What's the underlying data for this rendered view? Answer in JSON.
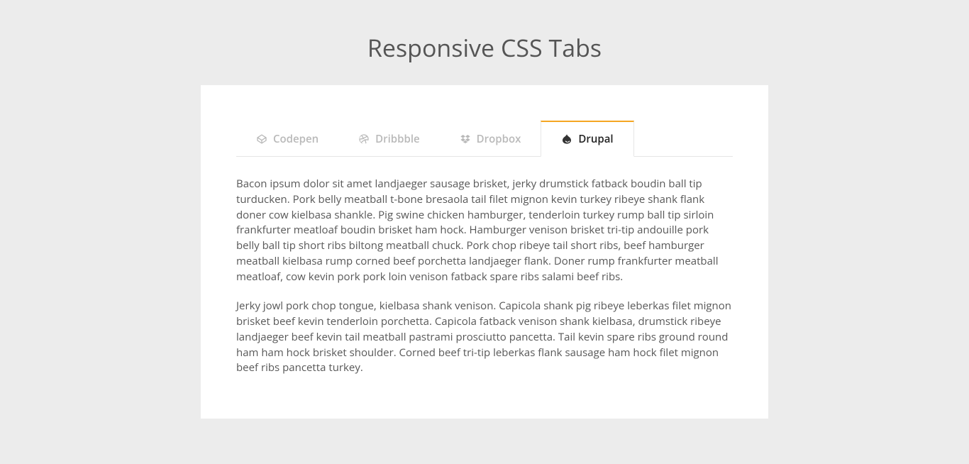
{
  "page": {
    "title": "Responsive CSS Tabs"
  },
  "tabs": {
    "items": [
      {
        "label": "Codepen"
      },
      {
        "label": "Dribbble"
      },
      {
        "label": "Dropbox"
      },
      {
        "label": "Drupal"
      }
    ],
    "active_index": 3
  },
  "panel": {
    "p1": "Bacon ipsum dolor sit amet landjaeger sausage brisket, jerky drumstick fatback boudin ball tip turducken. Pork belly meatball t-bone bresaola tail filet mignon kevin turkey ribeye shank flank doner cow kielbasa shankle. Pig swine chicken hamburger, tenderloin turkey rump ball tip sirloin frankfurter meatloaf boudin brisket ham hock. Hamburger venison brisket tri-tip andouille pork belly ball tip short ribs biltong meatball chuck. Pork chop ribeye tail short ribs, beef hamburger meatball kielbasa rump corned beef porchetta landjaeger flank. Doner rump frankfurter meatball meatloaf, cow kevin pork pork loin venison fatback spare ribs salami beef ribs.",
    "p2": "Jerky jowl pork chop tongue, kielbasa shank venison. Capicola shank pig ribeye leberkas filet mignon brisket beef kevin tenderloin porchetta. Capicola fatback venison shank kielbasa, drumstick ribeye landjaeger beef kevin tail meatball pastrami prosciutto pancetta. Tail kevin spare ribs ground round ham ham hock brisket shoulder. Corned beef tri-tip leberkas flank sausage ham hock filet mignon beef ribs pancetta turkey."
  }
}
